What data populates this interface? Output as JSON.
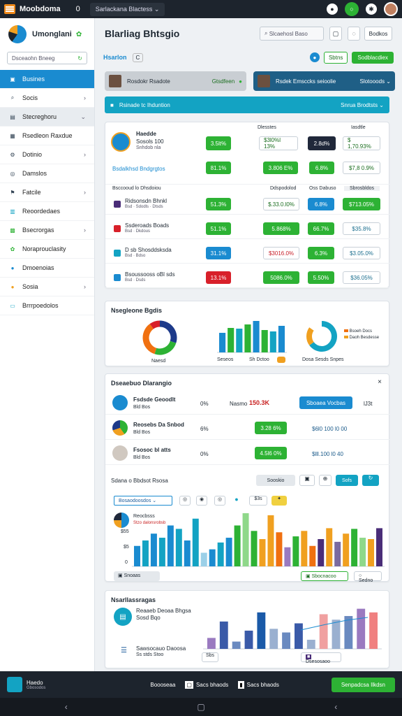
{
  "topbar": {
    "app": "Moobdoma",
    "counter": "0",
    "workspace": "Sarlackana Blactess ⌄"
  },
  "sidebar": {
    "title": "Umonglani",
    "search_placeholder": "Dsceaohn Bneeg",
    "items": [
      {
        "label": "Busines",
        "icon": "home-icon",
        "active": true
      },
      {
        "label": "Socis",
        "icon": "search-icon",
        "chev": true
      },
      {
        "label": "Stecreghoru",
        "icon": "folder-icon",
        "sel": true,
        "chev": true
      },
      {
        "label": "Rsedleon Raxdue",
        "icon": "doc-icon"
      },
      {
        "label": "Dotinio",
        "icon": "settings-icon",
        "chev": true
      },
      {
        "label": "Damslos",
        "icon": "chat-icon"
      },
      {
        "label": "Fatcile",
        "icon": "flag-icon",
        "chev": true
      },
      {
        "label": "Reoordedaes",
        "icon": "calendar-icon"
      },
      {
        "label": "Bsecrorgas",
        "icon": "grid-icon",
        "chev": true
      },
      {
        "label": "Noraprouclasity",
        "icon": "leaf-icon"
      },
      {
        "label": "Dmoenoias",
        "icon": "drop-icon"
      },
      {
        "label": "Sosia",
        "icon": "sun-icon",
        "chev": true
      },
      {
        "label": "Brrrpoedolos",
        "icon": "export-icon"
      }
    ]
  },
  "header": {
    "title": "Blarliag Bhtsgio",
    "search": "Slcaehosl Baso",
    "select": "Bodkos"
  },
  "row2": {
    "label": "Hsarlon",
    "chip": "C",
    "btn1": "Sbtns",
    "btn2": "Sodblacdiex"
  },
  "users": [
    {
      "name": "Rosdokr Rsadote",
      "action": "Gtsdfeen"
    },
    {
      "name": "Rsdek Emsccks seioolie",
      "action": "Slotooods ⌄"
    }
  ],
  "banner": {
    "text": "Rsinade tc Ihduntion",
    "right": "Snrua  Brodtsts ⌄"
  },
  "card1": {
    "title": "Haedde",
    "sub": "Sosols 100",
    "sub2": "Snhdob nla",
    "top": {
      "h1": "Dlesstes",
      "h2": "Iasdtle",
      "p1": "3.5lt%",
      "p2": "$3l0%l 13%",
      "p3": "2.8d%",
      "p4": "$ 1,70.93%"
    },
    "row2": {
      "label": "Bsdalkhsd Bndgrgtos",
      "p1": "81.1%",
      "p2": "3.806 E%",
      "p3": "6.8%",
      "p4": "$7,8 0.9%"
    },
    "cols": [
      "Bsccooud lo Dhsdoiou",
      "Ddspodolod",
      "Oss Dabuso",
      "Sbrosbldos"
    ],
    "rows": [
      {
        "name": "Ridsonsdn Bhnkl",
        "sub": "Bsd · Sdodls · Dtsds",
        "color": "#4a2d78",
        "c1": "51.3%",
        "c1c": "pg",
        "c2": "$.33.0.l0%",
        "c2c": "po",
        "c3": "6.8%",
        "c3c": "pb",
        "c4": "$713.05%",
        "c4c": "pg"
      },
      {
        "name": "Ssderoads Boads",
        "sub": "Bsd · Dkdous",
        "color": "#d8202a",
        "c1": "51.1%",
        "c1c": "pg",
        "c2": "5.868%",
        "c2c": "pg",
        "c3": "66.7%",
        "c3c": "pg",
        "c4": "$35.8%",
        "c4c": "pob"
      },
      {
        "name": "D sb Shosddsksda",
        "sub": "Bsd · Bdso",
        "color": "#13a3c3",
        "c1": "31.1%",
        "c1c": "pb",
        "c2": "$3016.0%",
        "c2c": "por",
        "c3": "6.3%",
        "c3c": "pg",
        "c4": "$3.05.0%",
        "c4c": "pob"
      },
      {
        "name": "Bsoussooss oBl sds",
        "sub": "Bsd · Dsds",
        "color": "#1a8bd0",
        "c1": "13.1%",
        "c1c": "pr",
        "c2": "5086.0%",
        "c2c": "pg",
        "c3": "5.50%",
        "c3c": "pg",
        "c4": "$36.05%",
        "c4c": "pob"
      }
    ]
  },
  "card2": {
    "title": "Nsegleone Bgdis",
    "labels": [
      "Naesd",
      "Seseos",
      "Sh  Dctoo",
      "Dosa Sesds Snpes"
    ],
    "legend": [
      "Bsoeh Docs",
      "Daoh Besdesse"
    ]
  },
  "card3": {
    "title": "Dseaebuo Dlarangio",
    "rows": [
      {
        "name": "Fsdsde Geoodlt",
        "sub": "Bld Bos",
        "pct": "0%",
        "status": "Nasmo",
        "val": "150.3K",
        "btn": "Sboaea Vocbas",
        "end": "lJ3t"
      },
      {
        "name": "Reosebs Da Snbod",
        "sub": "Bld Bos",
        "pct": "6%",
        "val": "3.28 6%",
        "end": "$6l0 100  l0 00"
      },
      {
        "name": "Fsosoc bl atts",
        "sub": "Bld Bos",
        "pct": "0%",
        "val": "4.5l6 0%",
        "end": "$lll.100  l0 40"
      }
    ],
    "toolbar": {
      "label": "Sdana o Bbdsot Rsosa",
      "btn1": "Sooskio",
      "btn2": "Sofs"
    },
    "filter": {
      "select": "Bosaodoosdos",
      "b4": "$3s"
    },
    "chart_legend": {
      "title": "Reocbsss",
      "sub": "Stzo dalonsrobsb"
    },
    "yticks": [
      "$55",
      "$5",
      "0"
    ],
    "footer": {
      "left": "Snoaas",
      "right": "Sbocnacoo",
      "far": "Sedno"
    }
  },
  "card4": {
    "title": "Nsarllassragas",
    "item1": "Reaaeb Deoaa Bhgsa",
    "item1b": "Sosd Bqo",
    "item2": "Sawsocauo Daoosa",
    "item2b": "Ss stds Stoo",
    "btn1": "Sbs",
    "btn2": "Dsesosaoo"
  },
  "bottombar": {
    "brand": "Haedo",
    "brand_sub": "Gbosodos",
    "tab1": "Boooseaa",
    "tab2": "Sacs bhaods",
    "cta": "Senpadcsa Ilkdsn"
  },
  "chart_data": [
    {
      "type": "pie",
      "values": [
        30,
        25,
        35,
        10
      ],
      "colors": [
        "#1d3a8a",
        "#2db234",
        "#f07010",
        "#d8202a"
      ]
    },
    {
      "type": "bar",
      "values": [
        28,
        35,
        34,
        40,
        45,
        32,
        30,
        38
      ],
      "colors": [
        "#1a8bd0",
        "#2db234",
        "#13a3c3",
        "#2db234",
        "#1a8bd0",
        "#2db234",
        "#13a3c3",
        "#1a8bd0"
      ]
    },
    {
      "type": "pie",
      "values": [
        65,
        20,
        15
      ],
      "colors": [
        "#13a3c3",
        "#f0a020",
        "#ffffff"
      ]
    },
    {
      "type": "bar",
      "values": [
        30,
        38,
        48,
        42,
        60,
        55,
        38,
        70,
        20,
        25,
        35,
        42,
        60,
        78,
        52,
        40,
        75,
        50,
        28,
        44,
        52,
        30,
        40,
        56,
        36,
        48,
        55,
        42,
        40,
        56
      ],
      "colors": [
        "#1a8bd0",
        "#13a3c3",
        "#1a8bd0",
        "#13a3c3",
        "#1a8bd0",
        "#13a3c3",
        "#1a8bd0",
        "#13a3c3",
        "#9bd0e8",
        "#1a8bd0",
        "#13a3c3",
        "#1a8bd0",
        "#2db234",
        "#8fd88a",
        "#2db234",
        "#f0a020",
        "#f0a020",
        "#f07010",
        "#9a7ac0",
        "#2db234",
        "#f0a020",
        "#f07010",
        "#4a2d78",
        "#f0a020",
        "#7a6aa0",
        "#f0a020",
        "#2db234",
        "#8fd88a",
        "#f0a020",
        "#4a2d78"
      ]
    },
    {
      "type": "bar",
      "values": [
        12,
        30,
        8,
        20,
        40,
        22,
        18,
        28,
        10,
        38,
        32,
        36,
        44,
        40
      ],
      "colors": [
        "#9a7ac0",
        "#3a5aa8",
        "#6a8ac0",
        "#3a5aa8",
        "#1a5aa8",
        "#9ab0d0",
        "#6a8ac0",
        "#3a5aa8",
        "#9ab0d0",
        "#f0a0a0",
        "#9ab0d0",
        "#6a8ac0",
        "#9a7ac0",
        "#f08080"
      ]
    }
  ]
}
